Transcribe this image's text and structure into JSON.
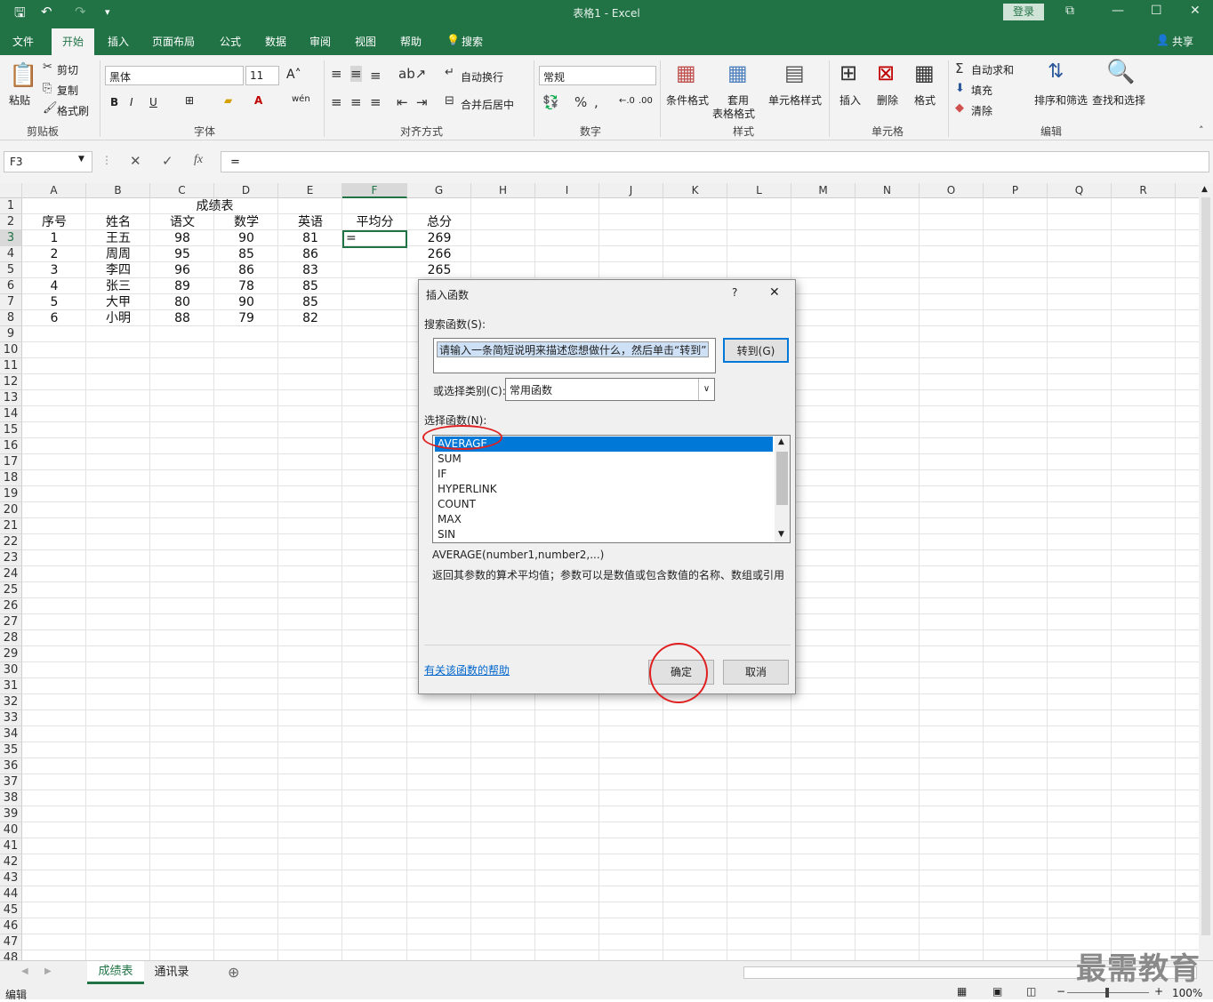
{
  "titlebar": {
    "title": "表格1  -  Excel",
    "login": "登录",
    "save_icon": "save-icon",
    "undo_icon": "undo-icon"
  },
  "tabs": [
    "文件",
    "开始",
    "插入",
    "页面布局",
    "公式",
    "数据",
    "审阅",
    "视图",
    "帮助",
    "搜索"
  ],
  "share": "共享",
  "ribbon": {
    "clipboard": {
      "paste": "粘贴",
      "cut": "剪切",
      "copy": "复制",
      "format_painter": "格式刷",
      "label": "剪贴板"
    },
    "font": {
      "name": "黑体",
      "size": "11",
      "label": "字体"
    },
    "align": {
      "wrap": "自动换行",
      "merge": "合并后居中",
      "label": "对齐方式"
    },
    "number": {
      "format": "常规",
      "label": "数字"
    },
    "styles": {
      "cond": "条件格式",
      "table1": "套用",
      "table2": "表格格式",
      "cell": "单元格样式",
      "label": "样式"
    },
    "cells": {
      "insert": "插入",
      "delete": "删除",
      "format": "格式",
      "label": "单元格"
    },
    "edit": {
      "autosum": "自动求和",
      "fill": "填充",
      "clear": "清除",
      "sort": "排序和筛选",
      "find": "查找和选择",
      "label": "编辑"
    }
  },
  "formula_bar": {
    "name_box": "F3",
    "formula": "="
  },
  "columns": [
    "A",
    "B",
    "C",
    "D",
    "E",
    "F",
    "G",
    "H",
    "I",
    "J",
    "K",
    "L",
    "M",
    "N",
    "O",
    "P",
    "Q",
    "R"
  ],
  "sheet": {
    "title": "成绩表",
    "headers": [
      "序号",
      "姓名",
      "语文",
      "数学",
      "英语",
      "平均分",
      "总分"
    ],
    "rows": [
      [
        "1",
        "王五",
        "98",
        "90",
        "81",
        "=",
        "269"
      ],
      [
        "2",
        "周周",
        "95",
        "85",
        "86",
        "",
        "266"
      ],
      [
        "3",
        "李四",
        "96",
        "86",
        "83",
        "",
        "265"
      ],
      [
        "4",
        "张三",
        "89",
        "78",
        "85",
        "",
        ""
      ],
      [
        "5",
        "大甲",
        "80",
        "90",
        "85",
        "",
        ""
      ],
      [
        "6",
        "小明",
        "88",
        "79",
        "82",
        "",
        ""
      ]
    ]
  },
  "sheet_tabs": [
    "成绩表",
    "通讯录"
  ],
  "status": {
    "mode": "编辑",
    "zoom": "100%"
  },
  "dialog": {
    "title": "插入函数",
    "help_q": "?",
    "search_label": "搜索函数(S):",
    "search_value": "请输入一条简短说明来描述您想做什么，然后单击“转到”",
    "goto": "转到(G)",
    "category_label": "或选择类别(C):",
    "category": "常用函数",
    "select_label": "选择函数(N):",
    "functions": [
      "AVERAGE",
      "SUM",
      "IF",
      "HYPERLINK",
      "COUNT",
      "MAX",
      "SIN"
    ],
    "syntax": "AVERAGE(number1,number2,...)",
    "description": "返回其参数的算术平均值；参数可以是数值或包含数值的名称、数组或引用",
    "help_link": "有关该函数的帮助",
    "ok": "确定",
    "cancel": "取消"
  },
  "watermark": "最需教育"
}
